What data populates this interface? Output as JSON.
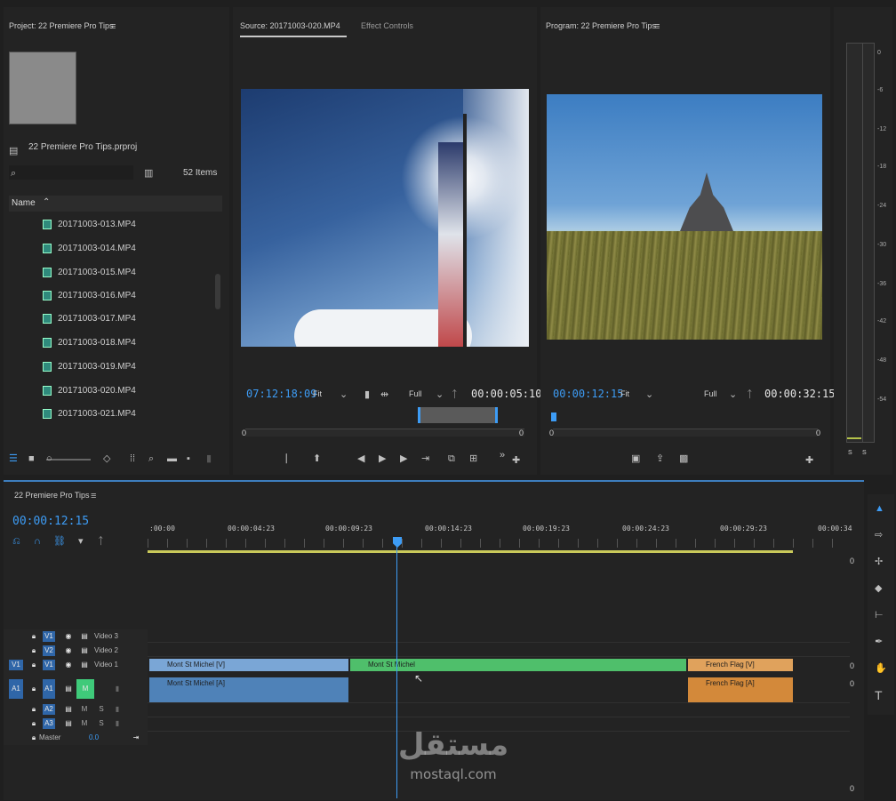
{
  "project": {
    "title": "Project: 22 Premiere Pro Tips",
    "file_name": "22 Premiere Pro Tips.prproj",
    "item_count": "52 Items",
    "name_column": "Name",
    "files": [
      "20171003-013.MP4",
      "20171003-014.MP4",
      "20171003-015.MP4",
      "20171003-016.MP4",
      "20171003-017.MP4",
      "20171003-018.MP4",
      "20171003-019.MP4",
      "20171003-020.MP4",
      "20171003-021.MP4"
    ]
  },
  "source": {
    "tab": "Source: 20171003-020.MP4",
    "tab2": "Effect Controls",
    "timecode": "07:12:18:09",
    "fit": "Fit",
    "quality": "Full",
    "duration": "00:00:05:10",
    "range_start": "0",
    "range_end": "0"
  },
  "program": {
    "tab": "Program: 22 Premiere Pro Tips",
    "timecode": "00:00:12:15",
    "fit": "Fit",
    "quality": "Full",
    "duration": "00:00:32:15",
    "range_start": "0",
    "range_end": "0"
  },
  "meter": {
    "labels": [
      "0",
      "-6",
      "-12",
      "-18",
      "-24",
      "-30",
      "-36",
      "-42",
      "-48",
      "-54"
    ],
    "solo_left": "S",
    "solo_right": "S"
  },
  "timeline": {
    "tab": "22 Premiere Pro Tips",
    "timecode": "00:00:12:15",
    "ruler": [
      ":00:00",
      "00:00:04:23",
      "00:00:09:23",
      "00:00:14:23",
      "00:00:19:23",
      "00:00:24:23",
      "00:00:29:23",
      "00:00:34"
    ],
    "video_tracks": [
      {
        "label": "V1",
        "name": "Video 3"
      },
      {
        "label": "V2",
        "name": "Video 2"
      },
      {
        "label": "V1",
        "name": "Video 1",
        "source": "V1"
      }
    ],
    "audio_tracks": [
      {
        "label": "A1",
        "source": "A1",
        "m": "M"
      },
      {
        "label": "A2",
        "m": "M",
        "s": "S"
      },
      {
        "label": "A3",
        "m": "M",
        "s": "S"
      }
    ],
    "master": {
      "label": "Master",
      "value": "0.0"
    },
    "clips": {
      "v1": [
        {
          "name": "Mont St Michel [V]",
          "color": "#7aa6d6"
        },
        {
          "name": "Mont St Michel",
          "color": "#4fbf6b"
        },
        {
          "name": "French Flag [V]",
          "color": "#e0a25c"
        }
      ],
      "a1": [
        {
          "name": "Mont St Michel [A]",
          "color": "#4f82b8"
        },
        {
          "name": "French Flag [A]",
          "color": "#d3893a"
        }
      ]
    },
    "track_end": "0"
  },
  "watermark": {
    "arabic": "مستقل",
    "latin": "mostaql.com"
  },
  "tools": {
    "type_tool": "T"
  }
}
